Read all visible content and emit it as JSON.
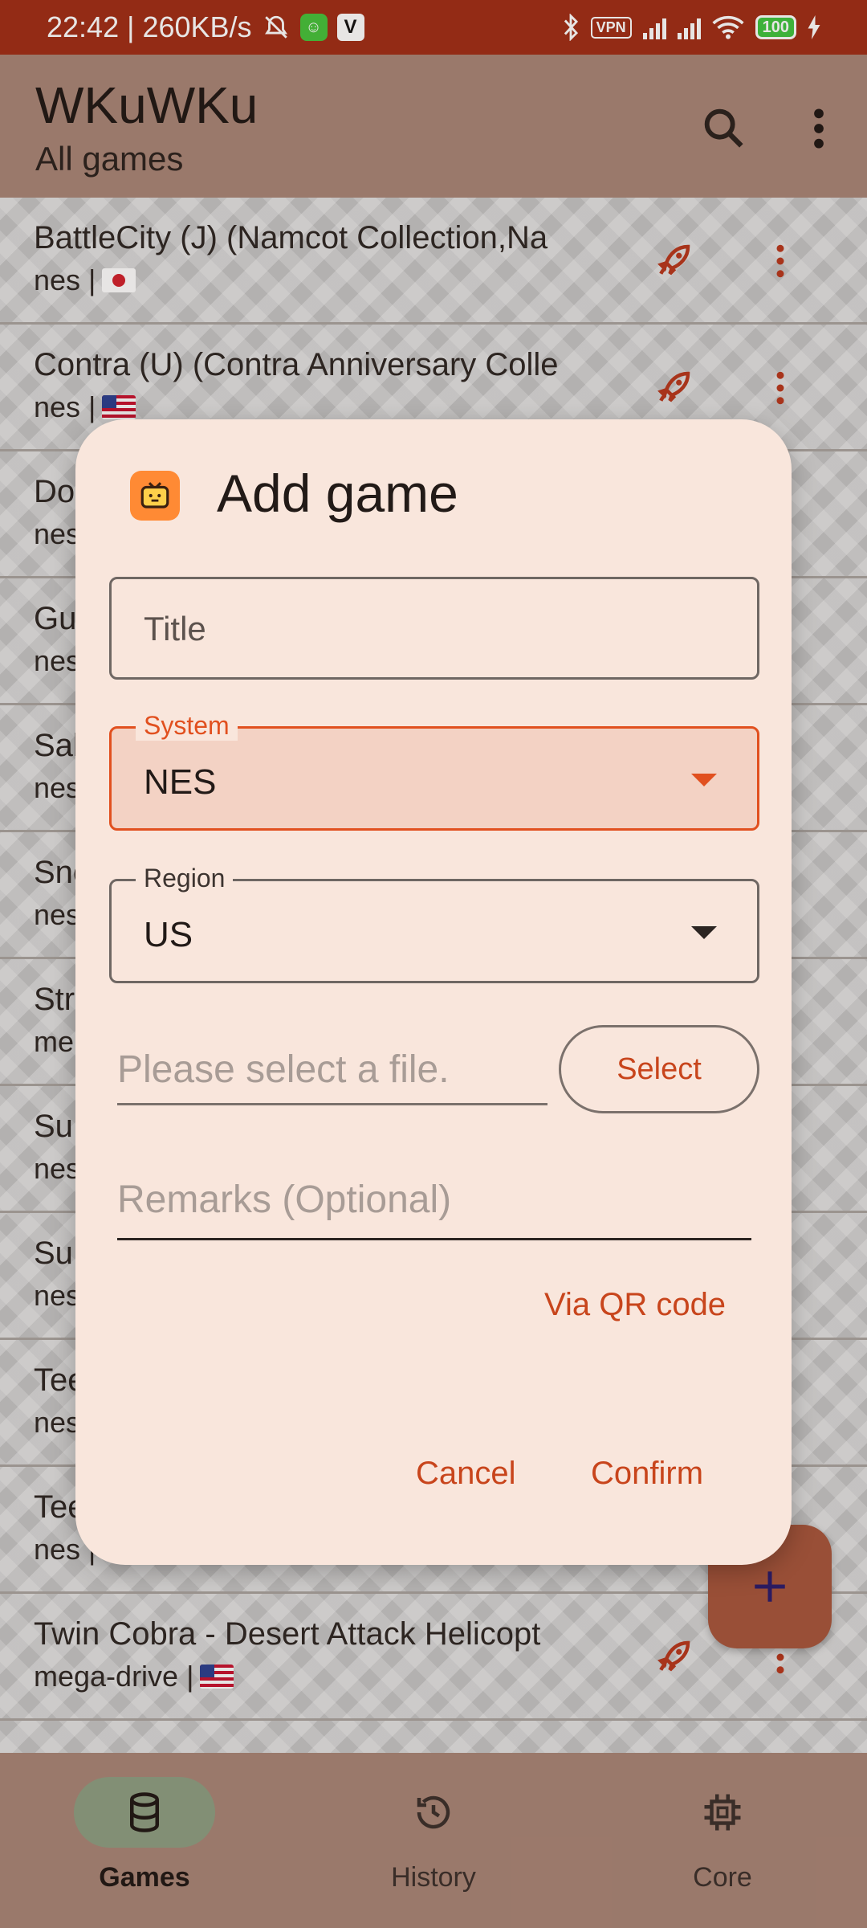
{
  "status_bar": {
    "time_speed": "22:42 | 260KB/s",
    "vpn": "VPN",
    "battery": "100"
  },
  "app_bar": {
    "title": "WKuWKu",
    "subtitle": "All games"
  },
  "games": [
    {
      "title": "BattleCity (J) (Namcot Collection,Na",
      "meta": "nes |",
      "flag": "jp"
    },
    {
      "title": "Contra (U) (Contra Anniversary Colle",
      "meta": "nes |",
      "flag": "us"
    },
    {
      "title": "Do",
      "meta": "nes",
      "flag": ""
    },
    {
      "title": "Gu",
      "meta": "nes",
      "flag": ""
    },
    {
      "title": "Sal",
      "meta": "nes",
      "flag": ""
    },
    {
      "title": "Sno",
      "meta": "nes",
      "flag": ""
    },
    {
      "title": "Stre",
      "meta": "me",
      "flag": ""
    },
    {
      "title": "Su",
      "meta": "nes",
      "flag": ""
    },
    {
      "title": "Su",
      "meta": "nes",
      "flag": ""
    },
    {
      "title": "Tee",
      "meta": "nes",
      "flag": ""
    },
    {
      "title": "Tee",
      "meta": "nes |",
      "flag": ""
    },
    {
      "title": "Twin Cobra - Desert Attack Helicopt",
      "meta": "mega-drive |",
      "flag": "us"
    }
  ],
  "dialog": {
    "title": "Add game",
    "title_placeholder": "Title",
    "system_label": "System",
    "system_value": "NES",
    "region_label": "Region",
    "region_value": "US",
    "file_placeholder": "Please select a file.",
    "select_label": "Select",
    "remarks_placeholder": "Remarks (Optional)",
    "qr_label": "Via QR code",
    "cancel_label": "Cancel",
    "confirm_label": "Confirm"
  },
  "nav": {
    "games": "Games",
    "history": "History",
    "core": "Core"
  },
  "colors": {
    "status_bar": "#a02c14",
    "app_bar": "#a88476",
    "accent": "#e1501f",
    "dialog_bg": "#f9e6dc",
    "fab": "#a7553b",
    "nav_active_pill": "#8d9e81"
  },
  "icons": {
    "search": "search-icon",
    "more": "more-vert-icon",
    "launch": "rocket-icon",
    "add": "plus-icon",
    "games": "database-icon",
    "history": "history-icon",
    "core": "chip-icon",
    "app": "tv-app-icon"
  }
}
